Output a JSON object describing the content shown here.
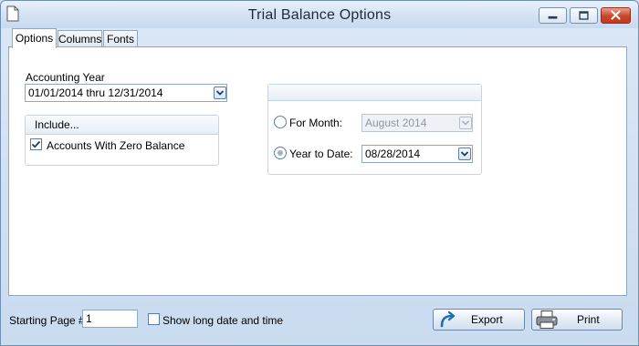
{
  "window": {
    "title": "Trial Balance Options",
    "controls": [
      "minimize-icon",
      "maximize-icon",
      "close-icon"
    ]
  },
  "tabs": [
    {
      "label": "Options",
      "active": true
    },
    {
      "label": "Columns",
      "active": false
    },
    {
      "label": "Fonts",
      "active": false
    }
  ],
  "options": {
    "accounting_year": {
      "label": "Accounting Year",
      "value": "01/01/2014 thru 12/31/2014"
    },
    "include": {
      "title": "Include...",
      "zero_balance_label": "Accounts With Zero Balance",
      "zero_balance_checked": true
    },
    "period": {
      "for_month_label": "For Month:",
      "for_month_value": "August 2014",
      "for_month_selected": false,
      "ytd_label": "Year to Date:",
      "ytd_value": "08/28/2014",
      "ytd_selected": true
    }
  },
  "footer": {
    "starting_page_label": "Starting Page #",
    "starting_page_value": "1",
    "long_date_label": "Show long date and time",
    "long_date_checked": false,
    "export_label": "Export",
    "print_label": "Print"
  },
  "colors": {
    "accent": "#5b7da5",
    "window_bg": "#cfe0f3",
    "close_button": "#c8452b"
  }
}
